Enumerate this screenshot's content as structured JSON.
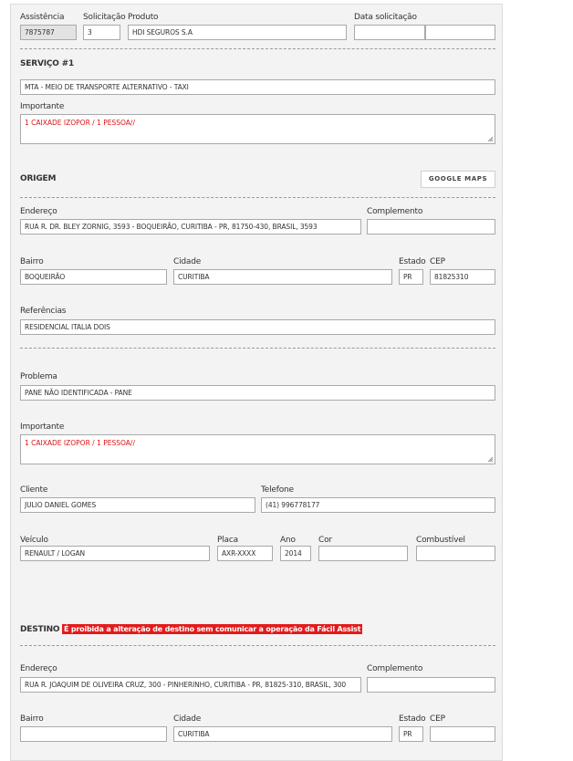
{
  "header": {
    "assistencia_label": "Assistência",
    "assistencia_value": "7875787",
    "solicitacao_label": "Solicitação",
    "solicitacao_value": "3",
    "produto_label": "Produto",
    "produto_value": "HDI SEGUROS S.A",
    "data_label": "Data solicitação",
    "data_value": "",
    "hora_value": ""
  },
  "servico": {
    "title": "SERVIÇO #1",
    "tipo_value": "MTA - MEIO DE TRANSPORTE ALTERNATIVO - TAXI",
    "importante_label": "Importante",
    "importante_value": "1 CAIXADE IZOPOR  /  1 PESSOA//"
  },
  "origem": {
    "title": "ORIGEM",
    "maps_button": "GOOGLE MAPS",
    "endereco_label": "Endereço",
    "endereco_value": "RUA R. DR. BLEY ZORNIG, 3593 - BOQUEIRÃO, CURITIBA - PR, 81750-430, BRASIL, 3593",
    "complemento_label": "Complemento",
    "complemento_value": "",
    "bairro_label": "Bairro",
    "bairro_value": "BOQUEIRÃO",
    "cidade_label": "Cidade",
    "cidade_value": "CURITIBA",
    "estado_label": "Estado",
    "estado_value": "PR",
    "cep_label": "CEP",
    "cep_value": "81825310",
    "referencias_label": "Referências",
    "referencias_value": "RESIDENCIAL ITALIA DOIS"
  },
  "problema": {
    "problema_label": "Problema",
    "problema_value": "PANE NÃO IDENTIFICADA - PANE",
    "importante_label": "Importante",
    "importante_value": "1 CAIXADE IZOPOR  /  1 PESSOA//",
    "cliente_label": "Cliente",
    "cliente_value": "JULIO DANIEL GOMES",
    "telefone_label": "Telefone",
    "telefone_value": "(41) 996778177",
    "veiculo_label": "Veículo",
    "veiculo_value": "RENAULT / LOGAN",
    "placa_label": "Placa",
    "placa_value": "AXR-XXXX",
    "ano_label": "Ano",
    "ano_value": "2014",
    "cor_label": "Cor",
    "cor_value": "",
    "combustivel_label": "Combustível",
    "combustivel_value": ""
  },
  "destino": {
    "title": "DESTINO",
    "warning": "É proibida a alteração de destino sem comunicar a operação da Fácil Assist",
    "endereco_label": "Endereço",
    "endereco_value": "RUA R. JOAQUIM DE OLIVEIRA CRUZ, 300 - PINHERINHO, CURITIBA - PR, 81825-310, BRASIL, 300",
    "complemento_label": "Complemento",
    "complemento_value": "",
    "bairro_label": "Bairro",
    "bairro_value": "",
    "cidade_label": "Cidade",
    "cidade_value": "CURITIBA",
    "estado_label": "Estado",
    "estado_value": "PR",
    "cep_label": "CEP",
    "cep_value": ""
  },
  "colors": {
    "panel": "#f3f3f3",
    "warning": "#e31b1b",
    "important_text": "#dd1111"
  }
}
